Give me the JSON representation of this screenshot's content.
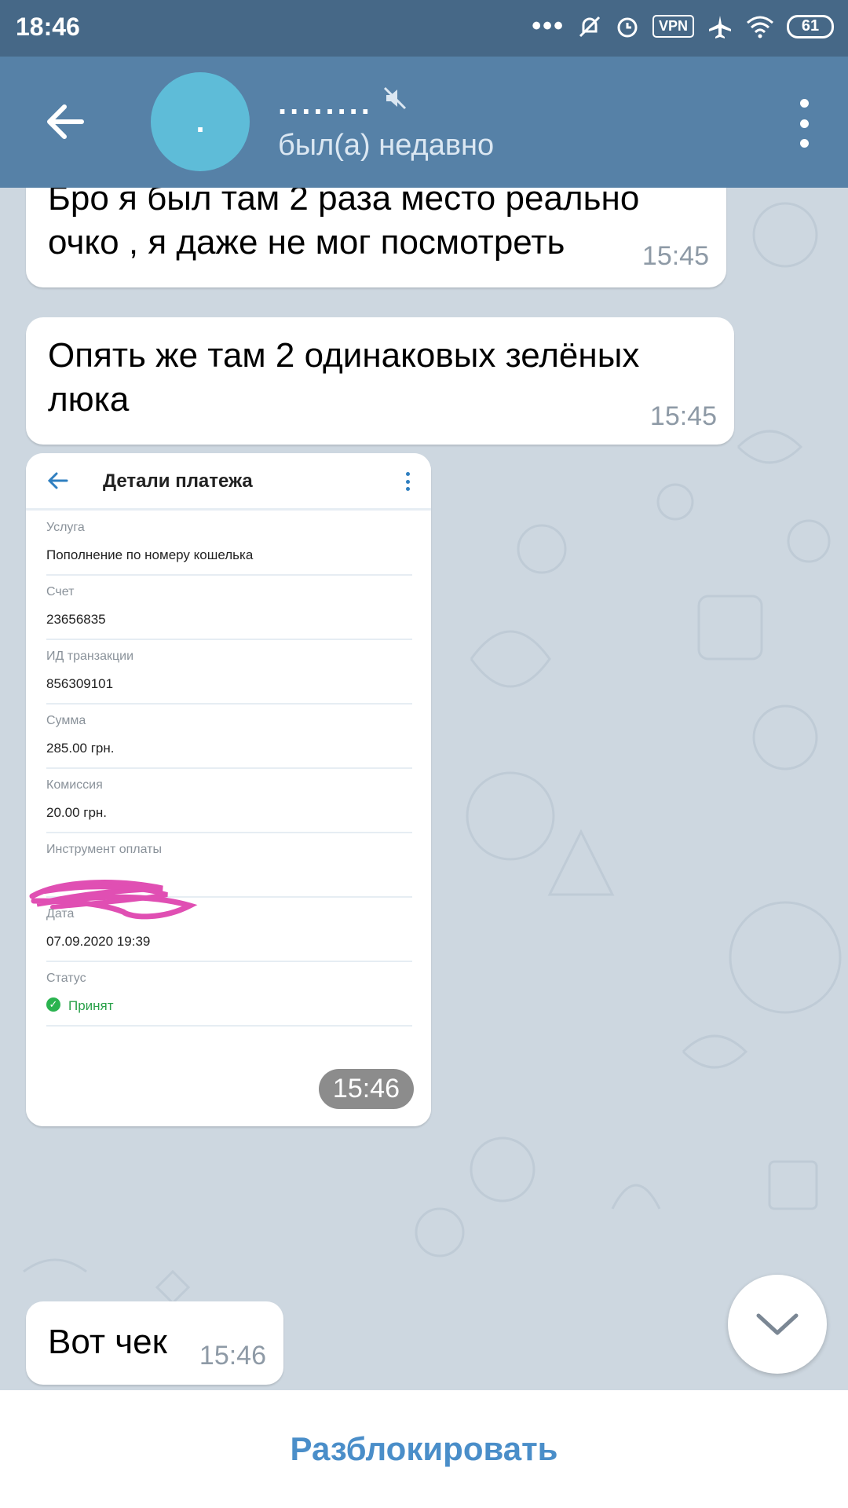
{
  "status_bar": {
    "time": "18:46",
    "dots": "•••",
    "vpn_label": "VPN",
    "battery": "61",
    "icons": [
      "dnd-icon",
      "alarm-icon",
      "vpn-icon",
      "airplane-icon",
      "wifi-icon",
      "battery-icon"
    ]
  },
  "header": {
    "avatar_text": ".",
    "chat_name": "........",
    "status": "был(а) недавно",
    "colors": {
      "appbar": "#5681a7",
      "avatar": "#5ebcd8"
    }
  },
  "messages": [
    {
      "text": "Бро я был там 2 раза место реально очко , я даже не мог посмотреть",
      "time": "15:45"
    },
    {
      "text": "Опять же там 2 одинаковых зелёных люка",
      "time": "15:45"
    },
    {
      "type": "image",
      "time": "15:46",
      "screenshot": {
        "title": "Детали платежа",
        "fields": [
          {
            "label": "Услуга",
            "value": "Пополнение по номеру кошелька"
          },
          {
            "label": "Счет",
            "value": "23656835"
          },
          {
            "label": "ИД транзакции",
            "value": "856309101"
          },
          {
            "label": "Сумма",
            "value": "285.00 грн."
          },
          {
            "label": "Комиссия",
            "value": "20.00 грн."
          },
          {
            "label": "Инструмент оплаты",
            "value": ""
          },
          {
            "label": "Дата",
            "value": "07.09.2020 19:39"
          },
          {
            "label": "Статус",
            "value": "Принят"
          }
        ]
      }
    },
    {
      "text": "Вот чек",
      "time": "15:46"
    }
  ],
  "bottom": {
    "unblock_label": "Разблокировать"
  }
}
